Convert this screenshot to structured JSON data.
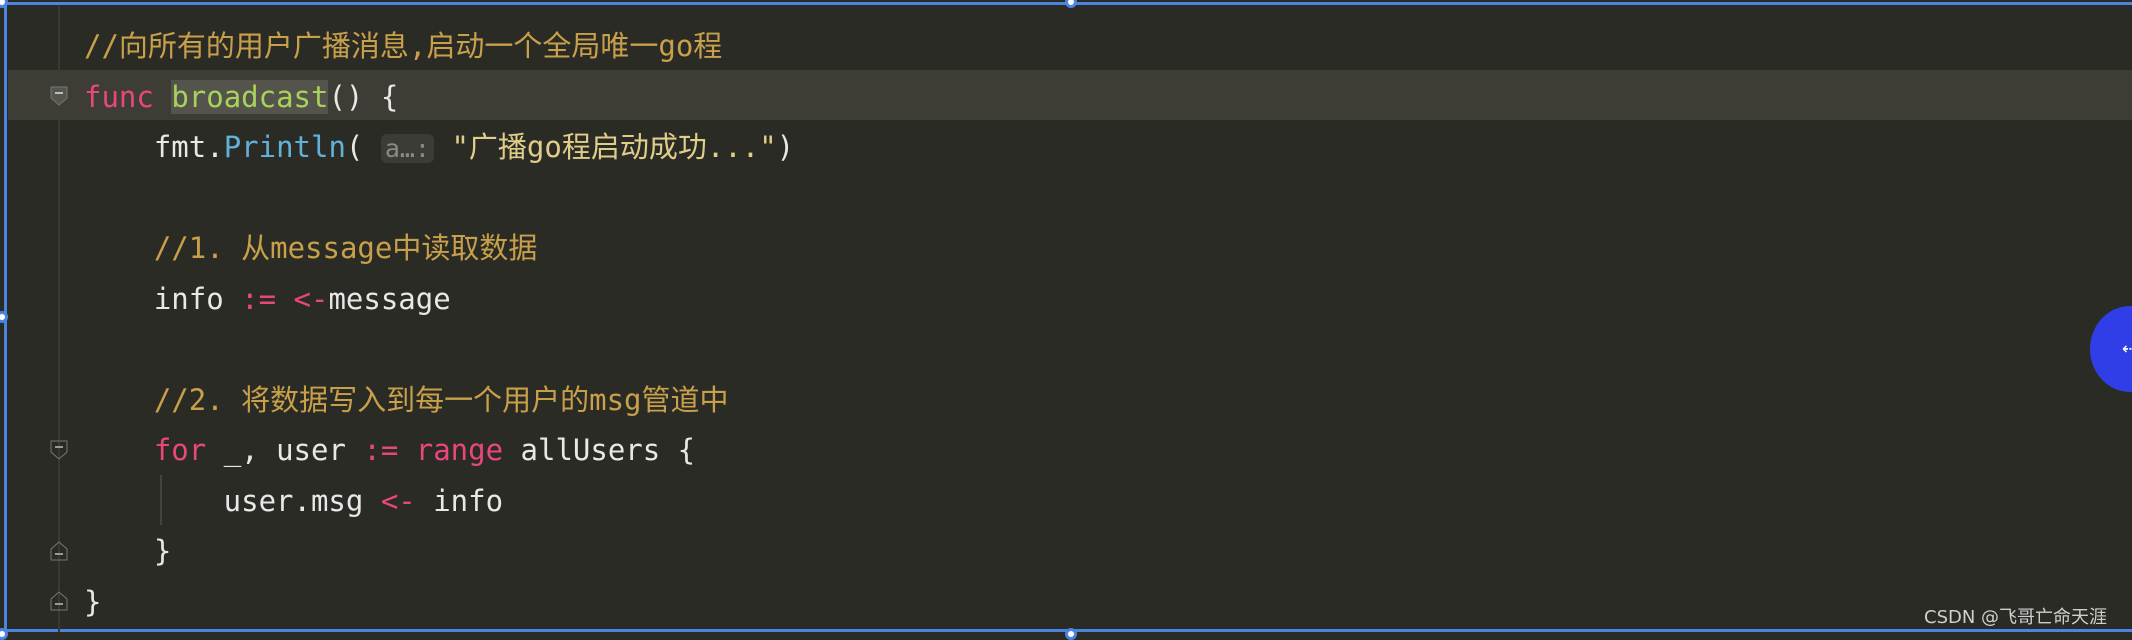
{
  "editor": {
    "language": "go",
    "lines": [
      [
        {
          "text": "//向所有的用户广播消息,启动一个全局唯一go程",
          "kind": "comment"
        }
      ],
      [
        {
          "text": "func",
          "kind": "keyword"
        },
        {
          "text": " ",
          "kind": "plain"
        },
        {
          "text": "broadcast",
          "kind": "fname"
        },
        {
          "text": "() {",
          "kind": "plain"
        }
      ],
      [
        {
          "text": "    fmt.",
          "kind": "plain"
        },
        {
          "text": "Println",
          "kind": "method"
        },
        {
          "text": "( ",
          "kind": "plain"
        },
        {
          "text": "a…:",
          "kind": "hint"
        },
        {
          "text": " \"广播go程启动成功...\"",
          "kind": "string"
        },
        {
          "text": ")",
          "kind": "plain"
        }
      ],
      [],
      [
        {
          "text": "    //1. 从message中读取数据",
          "kind": "comment"
        }
      ],
      [
        {
          "text": "    info ",
          "kind": "plain"
        },
        {
          "text": ":=",
          "kind": "op"
        },
        {
          "text": " ",
          "kind": "plain"
        },
        {
          "text": "<-",
          "kind": "op"
        },
        {
          "text": "message",
          "kind": "plain"
        }
      ],
      [],
      [
        {
          "text": "    //2. 将数据写入到每一个用户的msg管道中",
          "kind": "comment"
        }
      ],
      [
        {
          "text": "    ",
          "kind": "plain"
        },
        {
          "text": "for",
          "kind": "keyword"
        },
        {
          "text": " _, user ",
          "kind": "plain"
        },
        {
          "text": ":=",
          "kind": "op"
        },
        {
          "text": " ",
          "kind": "plain"
        },
        {
          "text": "range",
          "kind": "keyword"
        },
        {
          "text": " allUsers {",
          "kind": "plain"
        }
      ],
      [
        {
          "text": "        user.msg ",
          "kind": "plain"
        },
        {
          "text": "<-",
          "kind": "op"
        },
        {
          "text": " info",
          "kind": "plain"
        }
      ],
      [
        {
          "text": "    }",
          "kind": "plain"
        }
      ],
      [
        {
          "text": "}",
          "kind": "plain"
        }
      ]
    ],
    "highlighted_line": 2
  },
  "floating_button": {
    "icon": "resize-arrow-icon",
    "glyph": "⇠",
    "color": "#2f3ee6"
  },
  "watermark": "CSDN @飞哥亡命天涯",
  "colors": {
    "background": "#2b2b26",
    "comment": "#c9a04a",
    "keyword": "#e8467c",
    "function": "#a8d35a",
    "method": "#62b0d8",
    "selection_border": "#4a86e0"
  }
}
